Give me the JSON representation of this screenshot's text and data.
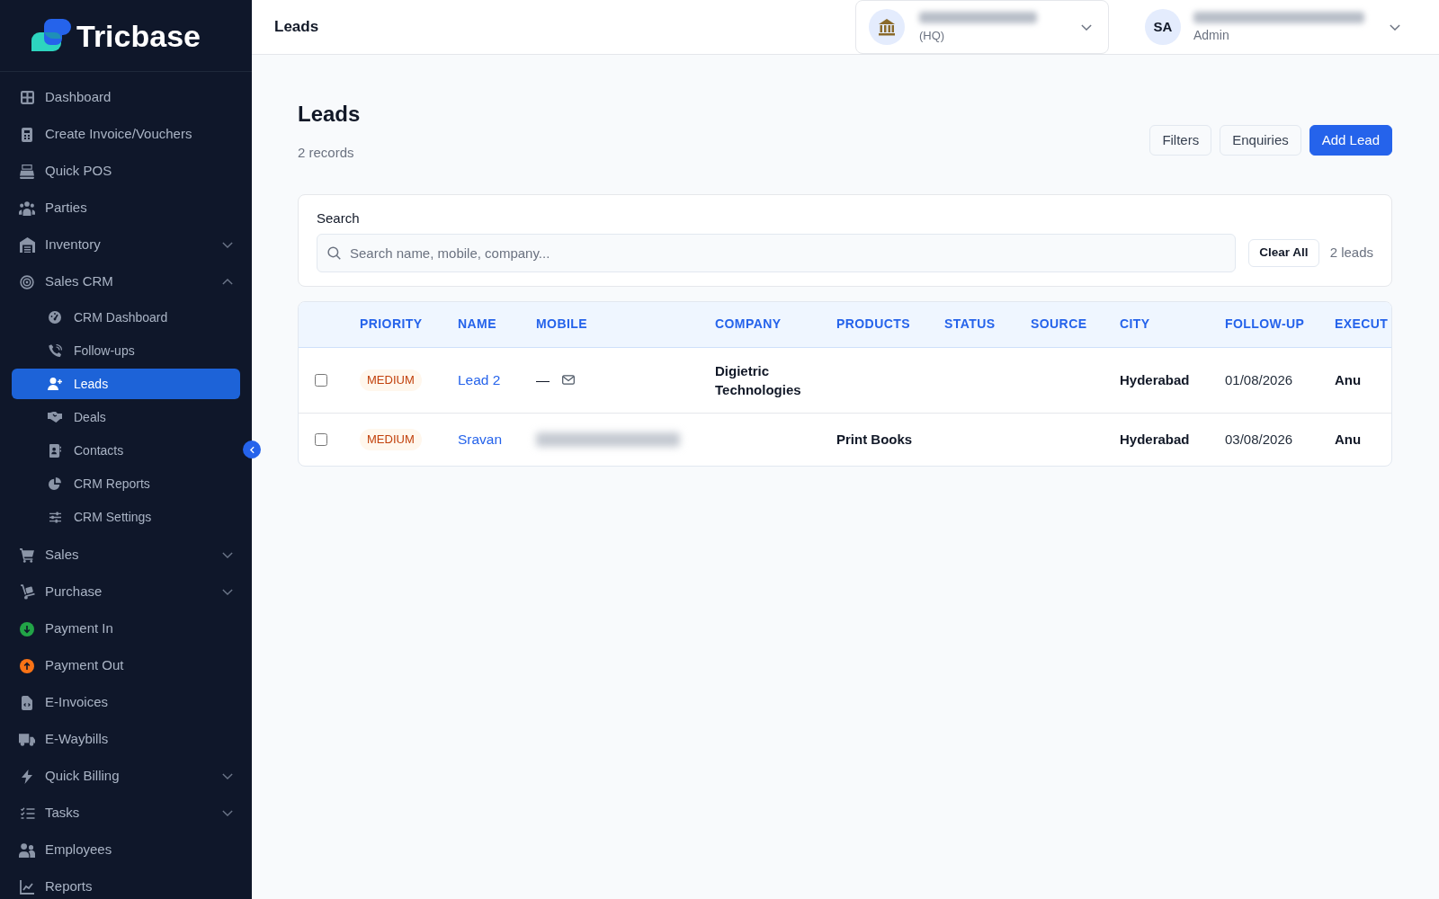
{
  "sidebar": {
    "logo": {
      "text": "Tricbase"
    },
    "items": [
      {
        "label": "Dashboard",
        "kind": "link",
        "selected": false
      },
      {
        "label": "Create Invoice/Vouchers",
        "kind": "link",
        "selected": false
      },
      {
        "label": "Quick POS",
        "kind": "link",
        "selected": false
      },
      {
        "label": "Parties",
        "kind": "link",
        "selected": false
      },
      {
        "label": "Inventory",
        "kind": "group",
        "expanded": false,
        "selected": false
      },
      {
        "label": "Sales CRM",
        "kind": "group",
        "expanded": true,
        "selected": false,
        "children": [
          {
            "label": "CRM Dashboard",
            "selected": false
          },
          {
            "label": "Follow-ups",
            "selected": false
          },
          {
            "label": "Leads",
            "selected": true
          },
          {
            "label": "Deals",
            "selected": false
          },
          {
            "label": "Contacts",
            "selected": false
          },
          {
            "label": "CRM Reports",
            "selected": false
          },
          {
            "label": "CRM Settings",
            "selected": false
          }
        ]
      },
      {
        "label": "Sales",
        "kind": "group",
        "expanded": false,
        "selected": false
      },
      {
        "label": "Purchase",
        "kind": "group",
        "expanded": false,
        "selected": false
      },
      {
        "label": "Payment In",
        "kind": "link",
        "selected": false
      },
      {
        "label": "Payment Out",
        "kind": "link",
        "selected": false
      },
      {
        "label": "E-Invoices",
        "kind": "link",
        "selected": false
      },
      {
        "label": "E-Waybills",
        "kind": "link",
        "selected": false
      },
      {
        "label": "Quick Billing",
        "kind": "group",
        "expanded": false,
        "selected": false
      },
      {
        "label": "Tasks",
        "kind": "group",
        "expanded": false,
        "selected": false
      },
      {
        "label": "Employees",
        "kind": "link",
        "selected": false
      },
      {
        "label": "Reports",
        "kind": "link",
        "selected": false
      }
    ]
  },
  "header": {
    "title": "Leads",
    "branch": {
      "label": "(HQ)"
    },
    "user": {
      "initials": "SA",
      "role": "Admin"
    }
  },
  "page": {
    "title": "Leads",
    "subtitle": "2 records",
    "buttons": [
      {
        "label": "Filters",
        "kind": "secondary"
      },
      {
        "label": "Enquiries",
        "kind": "secondary"
      },
      {
        "label": "Add Lead",
        "kind": "primary"
      }
    ]
  },
  "search": {
    "label": "Search",
    "placeholder": "Search name, mobile, company...",
    "clear_button": "Clear All",
    "count": "2 leads"
  },
  "table": {
    "columns": [
      "PRIORITY",
      "NAME",
      "MOBILE",
      "COMPANY",
      "PRODUCTS",
      "STATUS",
      "SOURCE",
      "CITY",
      "FOLLOW-UP",
      "EXECUT"
    ],
    "rows": [
      {
        "checked": false,
        "priority": "MEDIUM",
        "name": "Lead 2",
        "mobile": {
          "kind": "text",
          "text": "—"
        },
        "company": "Digietric Technologies",
        "city": "Hyderabad",
        "follow_up": "01/08/2026",
        "column_10": "Anu"
      },
      {
        "checked": false,
        "priority": "MEDIUM",
        "name": "Sravan",
        "mobile": {
          "kind": "redacted"
        },
        "products": "Print Books",
        "city": "Hyderabad",
        "follow_up": "03/08/2026",
        "column_10": "Anu"
      }
    ]
  }
}
